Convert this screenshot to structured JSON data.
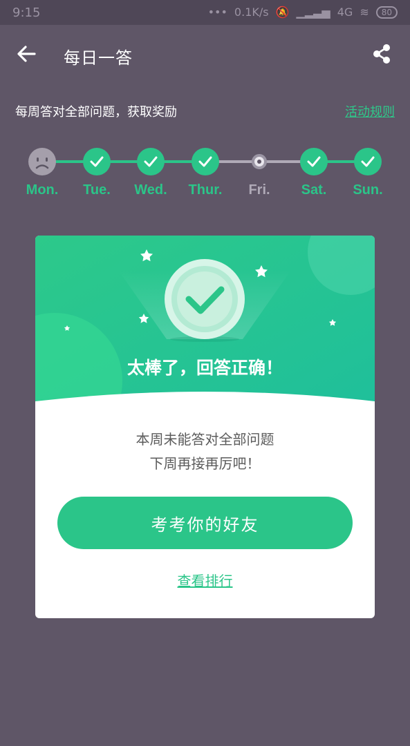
{
  "status": {
    "time": "9:15",
    "network": "0.1K/s",
    "signal": "4G",
    "battery": "80"
  },
  "header": {
    "title": "每日一答",
    "back_icon": "arrow-left-icon",
    "share_icon": "share-icon"
  },
  "promo": {
    "text": "每周答对全部问题，获取奖励",
    "rules_link": "活动规则"
  },
  "week": {
    "days": [
      {
        "label": "Mon.",
        "state": "missed"
      },
      {
        "label": "Tue.",
        "state": "correct"
      },
      {
        "label": "Wed.",
        "state": "correct"
      },
      {
        "label": "Thur.",
        "state": "correct"
      },
      {
        "label": "Fri.",
        "state": "pending"
      },
      {
        "label": "Sat.",
        "state": "correct"
      },
      {
        "label": "Sun.",
        "state": "correct"
      }
    ]
  },
  "result": {
    "title": "太棒了，回答正确！",
    "message_line1": "本周未能答对全部问题",
    "message_line2": "下周再接再厉吧！",
    "cta_button": "考考你的好友",
    "rank_link": "查看排行"
  },
  "colors": {
    "background": "#5f5667",
    "accent": "#2bc589",
    "muted": "#a59fab"
  }
}
